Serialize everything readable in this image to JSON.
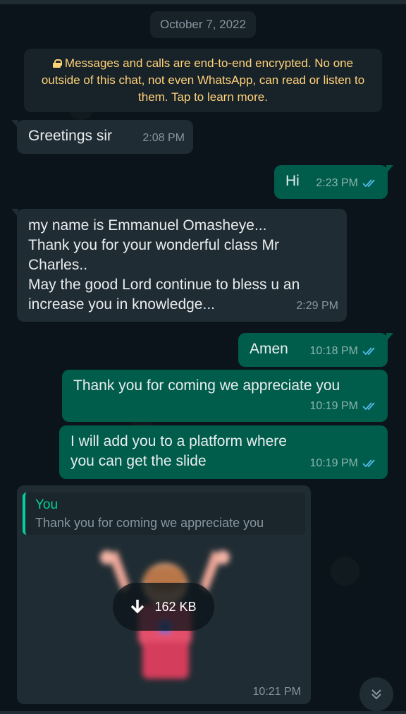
{
  "date_chip": "October 7, 2022",
  "encryption_notice": "Messages and calls are end-to-end encrypted. No one outside of this chat, not even WhatsApp, can read or listen to them. Tap to learn more.",
  "messages": [
    {
      "direction": "incoming",
      "text": "Greetings sir",
      "time": "2:08 PM"
    },
    {
      "direction": "outgoing",
      "text": "Hi",
      "time": "2:23 PM",
      "status": "read"
    },
    {
      "direction": "incoming",
      "text": "my name is Emmanuel Omasheye...\nThank you for your wonderful class Mr Charles..\nMay the good Lord continue to bless u an increase you in knowledge...",
      "time": "2:29 PM"
    },
    {
      "direction": "outgoing",
      "text": "Amen",
      "time": "10:18 PM",
      "status": "read"
    },
    {
      "direction": "outgoing",
      "text": "Thank you for coming we appreciate you",
      "time": "10:19 PM",
      "status": "read"
    },
    {
      "direction": "outgoing",
      "text": "I will add you to a platform where you can get the slide",
      "time": "10:19 PM",
      "status": "read"
    }
  ],
  "media_message": {
    "direction": "incoming",
    "reply_author": "You",
    "reply_text": "Thank you for coming we appreciate you",
    "download_size": "162 KB",
    "time": "10:21 PM"
  },
  "colors": {
    "background": "#0b141a",
    "incoming_bubble": "#202c33",
    "outgoing_bubble": "#005c4b",
    "read_ticks": "#53bdeb",
    "notice_text": "#ffd279",
    "reply_accent": "#06cf9c"
  },
  "icons": [
    "lock-icon",
    "double-check-icon",
    "download-icon",
    "chevron-double-down-icon"
  ]
}
